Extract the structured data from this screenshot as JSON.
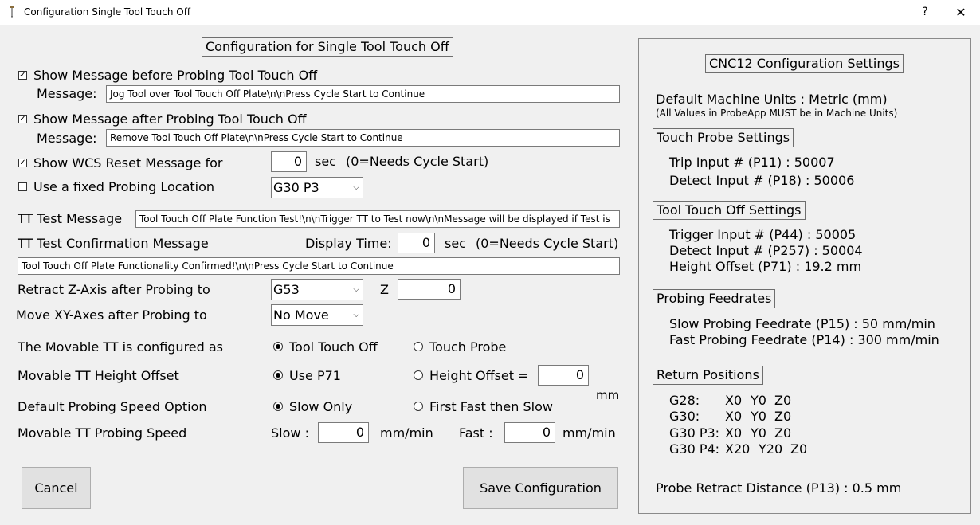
{
  "window": {
    "title": "Configuration Single Tool Touch Off",
    "help": "?",
    "close": "✕"
  },
  "main": {
    "heading": "Configuration for Single Tool Touch Off",
    "show_msg_before": {
      "label": "Show Message before Probing Tool Touch Off",
      "checked": true
    },
    "msg_before": {
      "label": "Message:",
      "value": "Jog Tool over Tool Touch Off Plate\\n\\nPress Cycle Start to Continue"
    },
    "show_msg_after": {
      "label": "Show Message after Probing Tool Touch Off",
      "checked": true
    },
    "msg_after": {
      "label": "Message:",
      "value": "Remove Tool Touch Off Plate\\n\\nPress Cycle Start to Continue"
    },
    "show_wcs": {
      "label": "Show WCS Reset Message for",
      "checked": true,
      "value": "0",
      "unit": "sec",
      "note": "(0=Needs Cycle Start)"
    },
    "fixed_loc": {
      "label": "Use a fixed Probing Location",
      "checked": false,
      "selected": "G30 P3"
    },
    "tt_test": {
      "label": "TT Test Message",
      "value": "Tool Touch Off Plate Function Test!\\n\\nTrigger TT to Test now\\n\\nMessage will be displayed if Test is"
    },
    "tt_confirm": {
      "label": "TT Test Confirmation Message",
      "display_label": "Display Time:",
      "display_value": "0",
      "unit": "sec",
      "note": "(0=Needs Cycle Start)",
      "value": "Tool Touch Off Plate Functionality Confirmed!\\n\\nPress Cycle Start to Continue"
    },
    "retract": {
      "label": "Retract Z-Axis after Probing to",
      "selected": "G53",
      "z_label": "Z",
      "z_value": "0"
    },
    "move_xy": {
      "label": "Move XY-Axes after Probing to",
      "selected": "No Move"
    },
    "movable_config": {
      "label": "The Movable TT is configured as",
      "opt1": "Tool Touch Off",
      "opt2": "Touch Probe",
      "selected": 1
    },
    "height_offset": {
      "label": "Movable TT Height Offset",
      "opt1": "Use P71",
      "opt2": "Height Offset =",
      "value": "0",
      "unit": "mm",
      "selected": 1
    },
    "probing_speed_opt": {
      "label": "Default Probing Speed Option",
      "opt1": "Slow Only",
      "opt2": "First Fast then Slow",
      "selected": 1
    },
    "probing_speed": {
      "label": "Movable TT Probing Speed",
      "slow_label": "Slow :",
      "slow_value": "0",
      "slow_unit": "mm/min",
      "fast_label": "Fast :",
      "fast_value": "0",
      "fast_unit": "mm/min"
    },
    "cancel": "Cancel",
    "save": "Save Configuration"
  },
  "settings": {
    "title": "CNC12 Configuration Settings",
    "units": "Default Machine Units : Metric (mm)",
    "units_note": "(All Values in ProbeApp MUST be in Machine Units)",
    "touch_probe_title": "Touch Probe Settings",
    "trip": "Trip Input # (P11) : 50007",
    "detect": "Detect Input # (P18) : 50006",
    "tto_title": "Tool Touch Off Settings",
    "trigger": "Trigger Input # (P44) : 50005",
    "tto_detect": "Detect Input # (P257) : 50004",
    "height": "Height Offset (P71) : 19.2 mm",
    "feed_title": "Probing Feedrates",
    "slow": "Slow Probing Feedrate (P15) : 50 mm/min",
    "fast": "Fast Probing Feedrate (P14) : 300 mm/min",
    "return_title": "Return Positions",
    "returns": [
      {
        "name": "G28:",
        "x": "X0",
        "y": "Y0",
        "z": "Z0"
      },
      {
        "name": "G30:",
        "x": "X0",
        "y": "Y0",
        "z": "Z0"
      },
      {
        "name": "G30 P3:",
        "x": "X0",
        "y": "Y0",
        "z": "Z0"
      },
      {
        "name": "G30 P4:",
        "x": "X20",
        "y": "Y20",
        "z": "Z0"
      }
    ],
    "retract_dist": "Probe Retract Distance (P13) : 0.5 mm"
  }
}
